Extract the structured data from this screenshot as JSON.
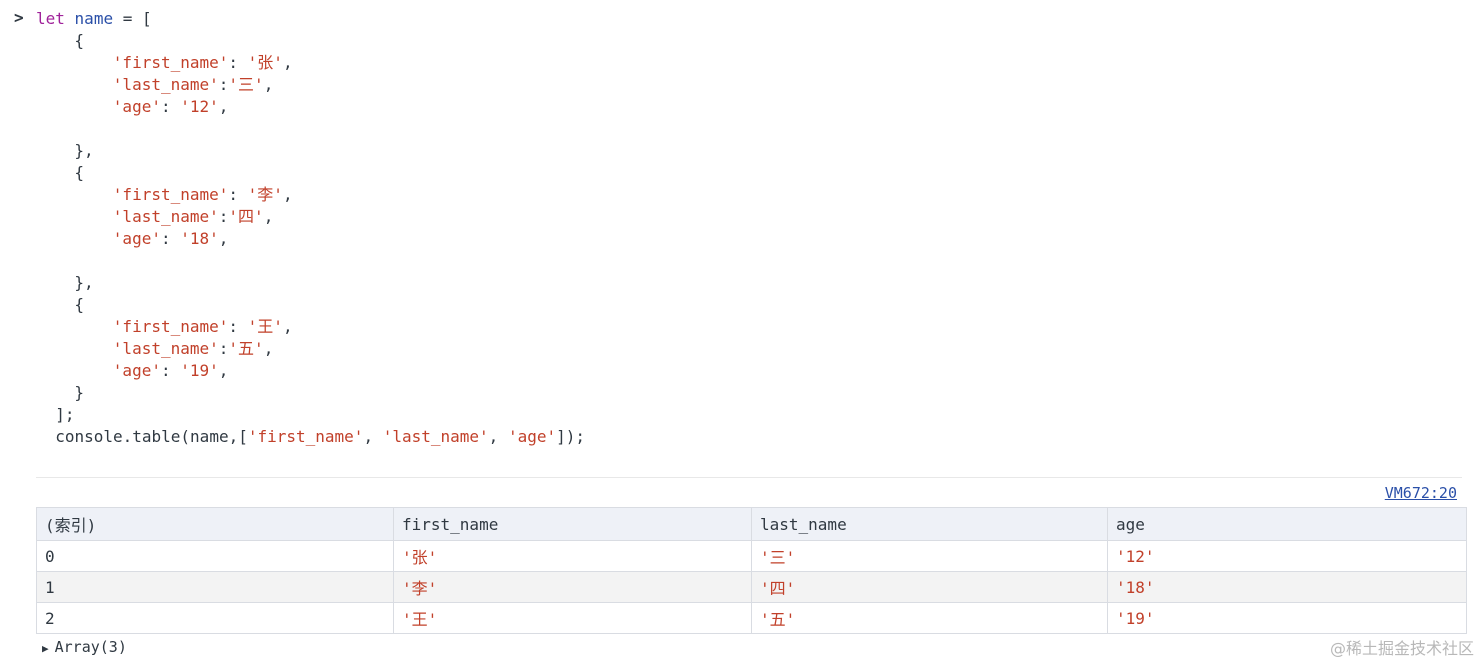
{
  "console_input": {
    "prompt": ">",
    "lines": [
      {
        "indent": 0,
        "tokens": [
          {
            "t": "let",
            "c": "kw"
          },
          {
            "t": " "
          },
          {
            "t": "name",
            "c": "id"
          },
          {
            "t": " = ["
          }
        ]
      },
      {
        "indent": 4,
        "tokens": [
          {
            "t": "{"
          }
        ]
      },
      {
        "indent": 8,
        "tokens": [
          {
            "t": "'first_name'",
            "c": "str"
          },
          {
            "t": ": "
          },
          {
            "t": "'张'",
            "c": "str"
          },
          {
            "t": ","
          }
        ]
      },
      {
        "indent": 8,
        "tokens": [
          {
            "t": "'last_name'",
            "c": "str"
          },
          {
            "t": ":"
          },
          {
            "t": "'三'",
            "c": "str"
          },
          {
            "t": ","
          }
        ]
      },
      {
        "indent": 8,
        "tokens": [
          {
            "t": "'age'",
            "c": "str"
          },
          {
            "t": ": "
          },
          {
            "t": "'12'",
            "c": "str"
          },
          {
            "t": ","
          }
        ]
      },
      {
        "indent": 0,
        "tokens": []
      },
      {
        "indent": 4,
        "tokens": [
          {
            "t": "},"
          }
        ]
      },
      {
        "indent": 4,
        "tokens": [
          {
            "t": "{"
          }
        ]
      },
      {
        "indent": 8,
        "tokens": [
          {
            "t": "'first_name'",
            "c": "str"
          },
          {
            "t": ": "
          },
          {
            "t": "'李'",
            "c": "str"
          },
          {
            "t": ","
          }
        ]
      },
      {
        "indent": 8,
        "tokens": [
          {
            "t": "'last_name'",
            "c": "str"
          },
          {
            "t": ":"
          },
          {
            "t": "'四'",
            "c": "str"
          },
          {
            "t": ","
          }
        ]
      },
      {
        "indent": 8,
        "tokens": [
          {
            "t": "'age'",
            "c": "str"
          },
          {
            "t": ": "
          },
          {
            "t": "'18'",
            "c": "str"
          },
          {
            "t": ","
          }
        ]
      },
      {
        "indent": 0,
        "tokens": []
      },
      {
        "indent": 4,
        "tokens": [
          {
            "t": "},"
          }
        ]
      },
      {
        "indent": 4,
        "tokens": [
          {
            "t": "{"
          }
        ]
      },
      {
        "indent": 8,
        "tokens": [
          {
            "t": "'first_name'",
            "c": "str"
          },
          {
            "t": ": "
          },
          {
            "t": "'王'",
            "c": "str"
          },
          {
            "t": ","
          }
        ]
      },
      {
        "indent": 8,
        "tokens": [
          {
            "t": "'last_name'",
            "c": "str"
          },
          {
            "t": ":"
          },
          {
            "t": "'五'",
            "c": "str"
          },
          {
            "t": ","
          }
        ]
      },
      {
        "indent": 8,
        "tokens": [
          {
            "t": "'age'",
            "c": "str"
          },
          {
            "t": ": "
          },
          {
            "t": "'19'",
            "c": "str"
          },
          {
            "t": ","
          }
        ]
      },
      {
        "indent": 4,
        "tokens": [
          {
            "t": "}"
          }
        ]
      },
      {
        "indent": 2,
        "tokens": [
          {
            "t": "];"
          }
        ]
      },
      {
        "indent": 2,
        "tokens": [
          {
            "t": "console.table(name,["
          },
          {
            "t": "'first_name'",
            "c": "str"
          },
          {
            "t": ", "
          },
          {
            "t": "'last_name'",
            "c": "str"
          },
          {
            "t": ", "
          },
          {
            "t": "'age'",
            "c": "str"
          },
          {
            "t": "]);"
          }
        ]
      }
    ]
  },
  "output": {
    "source_link": "VM672:20",
    "table": {
      "headers": [
        "(索引)",
        "first_name",
        "last_name",
        "age"
      ],
      "rows": [
        [
          "0",
          "'张'",
          "'三'",
          "'12'"
        ],
        [
          "1",
          "'李'",
          "'四'",
          "'18'"
        ],
        [
          "2",
          "'王'",
          "'五'",
          "'19'"
        ]
      ]
    },
    "array_summary": "Array(3)"
  },
  "watermark": "@稀土掘金技术社区",
  "colors": {
    "string": "#c1402a",
    "keyword": "#a0229a",
    "identifier": "#2a4fa8",
    "header_bg": "#eef1f7",
    "alt_row_bg": "#f3f3f3"
  }
}
